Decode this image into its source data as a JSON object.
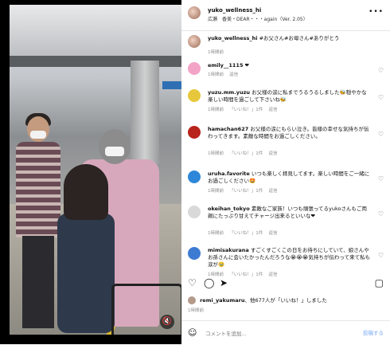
{
  "header": {
    "username": "yuko_wellness_hi",
    "subtitle": "広瀬　香美・DEAR・・・again（Ver. 2.05）",
    "more_icon": "ellipsis-icon"
  },
  "caption": {
    "username": "yuko_wellness_hi",
    "text": "#お父さん#お母さん#ありがとう",
    "time": "1時間前"
  },
  "comments": [
    {
      "username": "emily__1115",
      "text": "❤",
      "time": "1時間前",
      "likes": "",
      "reply": "返信",
      "avatar_color": "#f2a3c6"
    },
    {
      "username": "yuzu.mm.yuzu",
      "text": "お父様の涙に私までうるうるしました🐝穏やかな楽しい時間を過ごして下さいね🐝",
      "time": "1時間前",
      "likes": "「いいね！」1件",
      "reply": "返信",
      "avatar_color": "#e7c83c"
    },
    {
      "username": "hamachan627",
      "text": "お父様の涙にもらい泣き。皆様の幸せな気持ちが伝わってきます。素敵な時間をお過ごしください。",
      "time": "1時間前",
      "likes": "「いいね！」1件",
      "reply": "返信",
      "avatar_color": "#b8231c"
    },
    {
      "username": "uruha.favorite",
      "text": "いつも楽しく拝見してます。楽しい時間をご一緒にお過ごしください🤩",
      "time": "1時間前",
      "likes": "「いいね！」1件",
      "reply": "返信",
      "avatar_color": "#2e87d8"
    },
    {
      "username": "okeihan_tokyo",
      "text": "素敵なご家族！いつも頑張ってるyukoさんもご両親にたっぷり甘えてチャージ出来るといいな❤",
      "time": "1時間前",
      "likes": "「いいね！」1件",
      "reply": "返信",
      "avatar_color": "#d9d9d9"
    },
    {
      "username": "mimisakurana",
      "text": "すごくすごくこの日をお待ちにしていて、娘さんやお孫さんに会いたかったんだろうな😭😭😭気持ちが伝わって来て私も涙が🥹",
      "time": "1時間前",
      "likes": "「いいね！」1件",
      "reply": "返信",
      "avatar_color": "#3d7bd3"
    }
  ],
  "actions": {
    "like_icon": "heart-icon",
    "comment_icon": "comment-icon",
    "share_icon": "send-icon",
    "save_icon": "bookmark-icon"
  },
  "likes_line": {
    "user": "remi_yakumaru",
    "text": "、他677人が「いいね！」しました"
  },
  "post_time": "1時間前",
  "composer": {
    "placeholder": "コメントを追加...",
    "post_label": "投稿する",
    "emoji_icon": "smile-icon"
  },
  "video": {
    "mute_icon": "muted-speaker-icon"
  }
}
